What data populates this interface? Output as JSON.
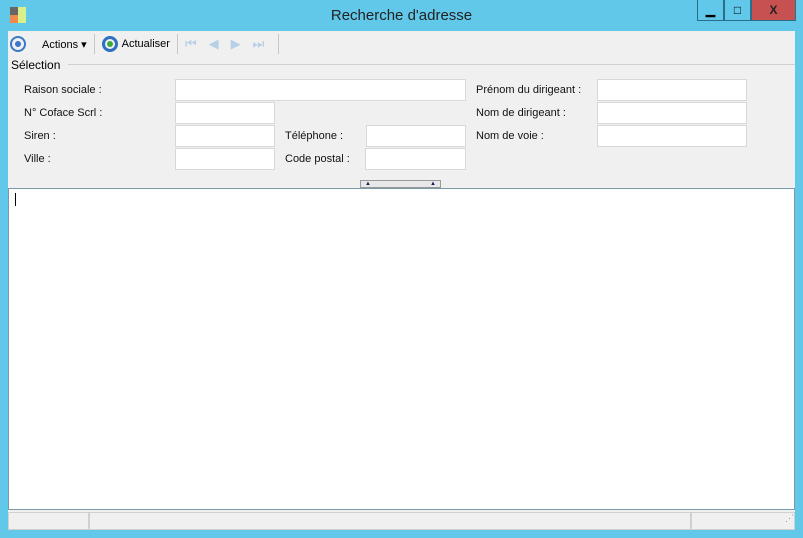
{
  "window": {
    "title": "Recherche d'adresse",
    "minimize": "▁",
    "maximize": "□",
    "close": "X"
  },
  "toolbar": {
    "actions": "Actions",
    "refresh": "Actualiser"
  },
  "selection": {
    "group_label": "Sélection",
    "fields": {
      "raison_sociale": {
        "label": "Raison sociale :",
        "value": ""
      },
      "coface": {
        "label": "N° Coface Scrl :",
        "value": ""
      },
      "siren": {
        "label": "Siren :",
        "value": ""
      },
      "ville": {
        "label": "Ville :",
        "value": ""
      },
      "telephone": {
        "label": "Téléphone :",
        "value": ""
      },
      "code_postal": {
        "label": "Code postal :",
        "value": ""
      },
      "prenom": {
        "label": "Prénom du dirigeant :",
        "value": ""
      },
      "nom": {
        "label": "Nom de dirigeant :",
        "value": ""
      },
      "voie": {
        "label": "Nom de voie :",
        "value": ""
      }
    }
  }
}
